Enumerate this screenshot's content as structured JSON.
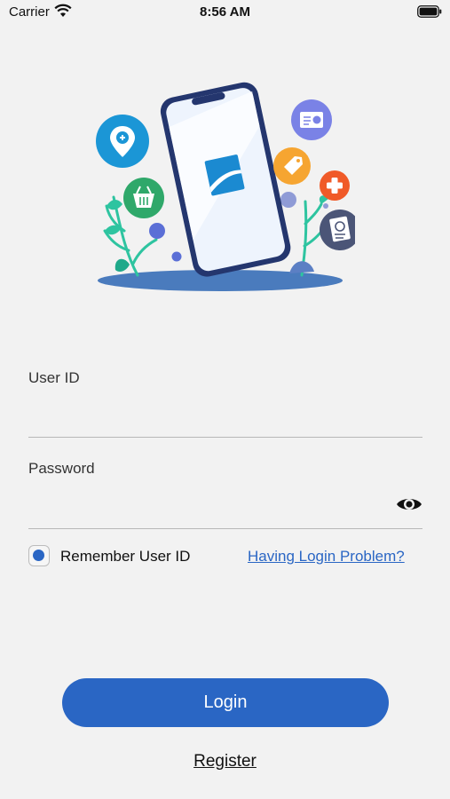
{
  "status_bar": {
    "carrier": "Carrier",
    "time": "8:56 AM"
  },
  "login_form": {
    "user_id_label": "User ID",
    "user_id_value": "",
    "password_label": "Password",
    "password_value": "",
    "remember_label": "Remember User ID",
    "remember_checked": true,
    "login_problem_link": "Having Login Problem?",
    "login_button": "Login",
    "register_link": "Register"
  },
  "colors": {
    "accent": "#2a66c4",
    "background": "#f2f2f2"
  },
  "icons": [
    "wifi-icon",
    "battery-icon",
    "eye-icon",
    "map-pin-icon",
    "basket-icon",
    "id-card-icon",
    "price-tag-icon",
    "medical-cross-icon",
    "receipt-icon",
    "logo-icon"
  ]
}
